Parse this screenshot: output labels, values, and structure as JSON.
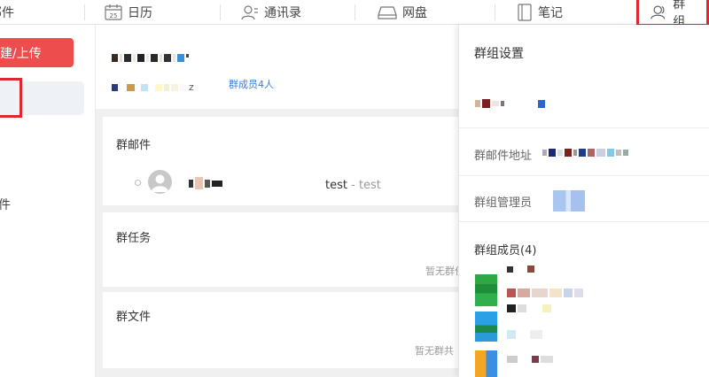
{
  "nav": {
    "mail": "邮件",
    "calendar": "日历",
    "calendar_date": "25",
    "contacts": "通讯录",
    "disk": "网盘",
    "notes": "笔记",
    "groups": "群组"
  },
  "sidebar": {
    "upload_button": "建/上传",
    "item_fragment": "件"
  },
  "group": {
    "name_fragment": "z",
    "member_count": "群成员4人"
  },
  "cards": {
    "mail": {
      "title": "群邮件",
      "subject": "test",
      "subject_sub": "test"
    },
    "tasks": {
      "title": "群任务",
      "empty": "暂无群任"
    },
    "files": {
      "title": "群文件",
      "empty": "暂无群共"
    }
  },
  "panel": {
    "title": "群组设置",
    "mail_address_label": "群邮件地址",
    "admin_label": "群组管理员",
    "members_label": "群组成员(4)"
  },
  "colors": {
    "accent_red": "#e0282c",
    "upload_red": "#ee4d4d",
    "link_blue": "#3f7fd1"
  }
}
